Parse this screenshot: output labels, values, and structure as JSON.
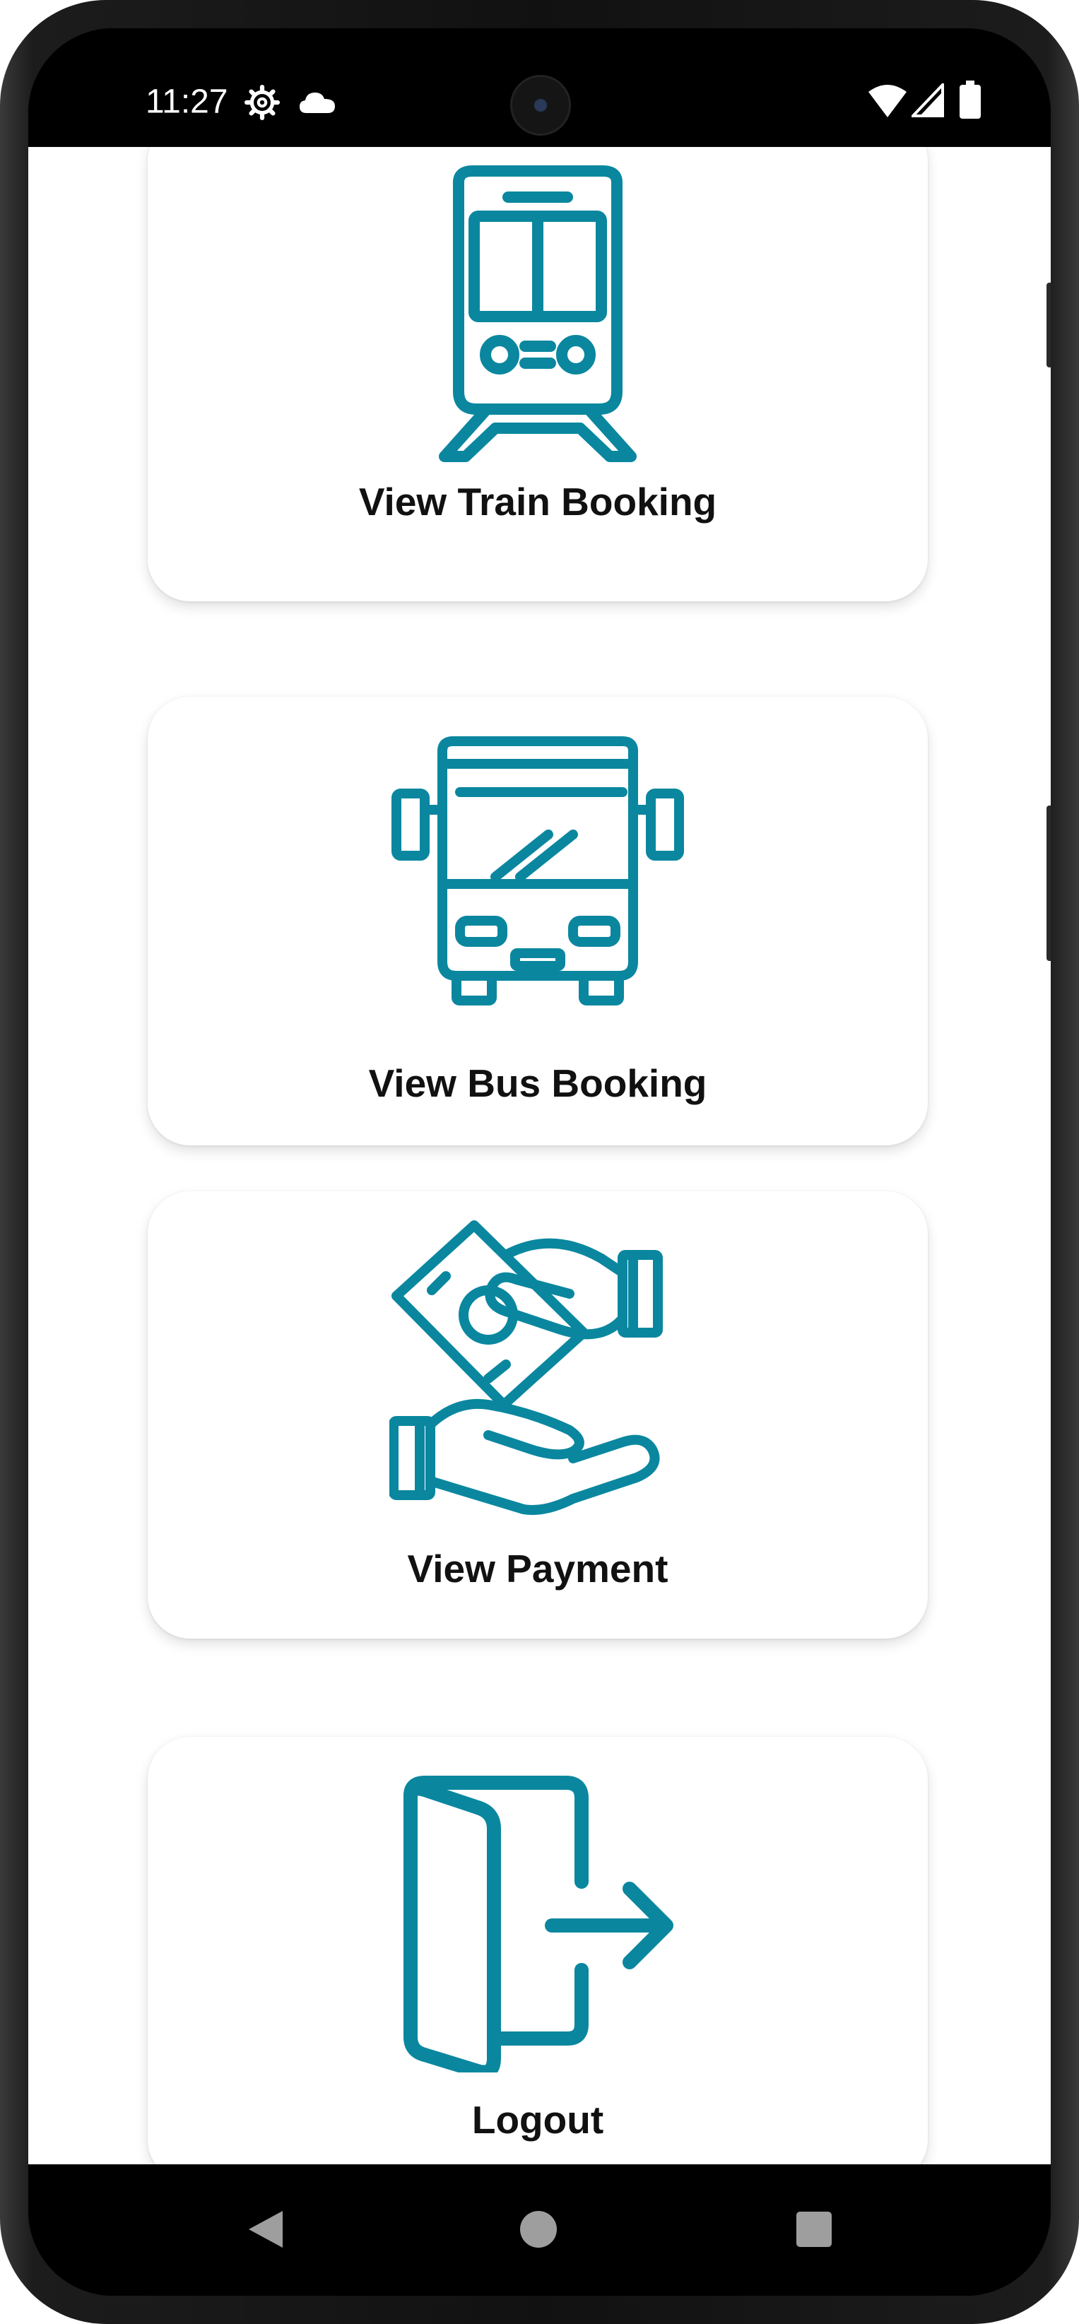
{
  "status_bar": {
    "time": "11:27",
    "icons": [
      "settings-gear-icon",
      "cloud-icon",
      "wifi-icon",
      "signal-icon",
      "battery-icon"
    ]
  },
  "menu": {
    "accent_color": "#0a879f",
    "items": [
      {
        "label": "View Train Booking",
        "icon": "train-icon"
      },
      {
        "label": "View Bus Booking",
        "icon": "bus-icon"
      },
      {
        "label": "View Payment",
        "icon": "payment-hands-icon"
      },
      {
        "label": "Logout",
        "icon": "logout-door-icon"
      }
    ]
  },
  "nav_bar": {
    "buttons": [
      "back-icon",
      "home-icon",
      "recents-icon"
    ]
  }
}
